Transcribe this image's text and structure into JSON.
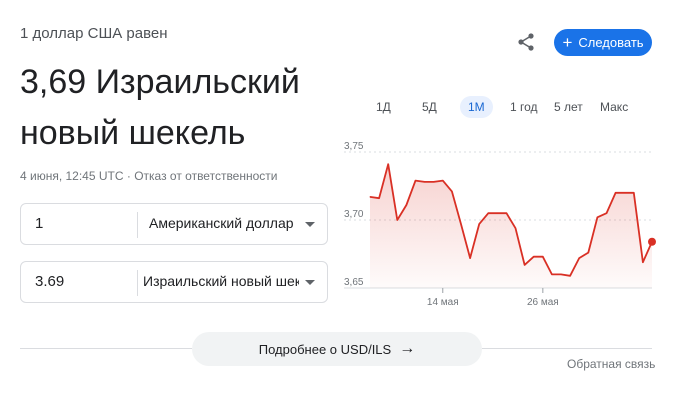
{
  "header": {
    "subtitle": "1 доллар США равен",
    "rate_line1": "3,69 Израильский",
    "rate_line2": "новый шекель",
    "date": "4 июня, 12:45 UTC",
    "disclaimer": "Отказ от ответственности",
    "meta_sep": " · "
  },
  "actions": {
    "share_icon": "share-icon",
    "follow_label": "Следовать",
    "follow_color": "#1a73e8"
  },
  "converter": {
    "from_value": "1",
    "from_currency": "Американский доллар",
    "to_value": "3.69",
    "to_currency": "Израильский новый шекель"
  },
  "tabs": [
    "1Д",
    "5Д",
    "1М",
    "1 год",
    "5 лет",
    "Макс"
  ],
  "active_tab": "1М",
  "chart_data": {
    "type": "line",
    "y_ticks": [
      "3,75",
      "3,70",
      "3,65"
    ],
    "y_tick_values": [
      3.75,
      3.7,
      3.65
    ],
    "ylim": [
      3.65,
      3.75
    ],
    "x_ticks": [
      "14 мая",
      "26 мая"
    ],
    "x_tick_index": [
      8,
      19
    ],
    "series_color": "#d93025",
    "values": [
      3.717,
      3.716,
      3.741,
      3.7,
      3.711,
      3.729,
      3.728,
      3.728,
      3.729,
      3.721,
      3.697,
      3.672,
      3.697,
      3.705,
      3.705,
      3.705,
      3.694,
      3.667,
      3.673,
      3.673,
      3.66,
      3.66,
      3.659,
      3.672,
      3.676,
      3.702,
      3.705,
      3.72,
      3.72,
      3.72,
      3.669,
      3.684
    ]
  },
  "footer": {
    "more_label": "Подробнее о USD/ILS",
    "feedback": "Обратная связь"
  }
}
